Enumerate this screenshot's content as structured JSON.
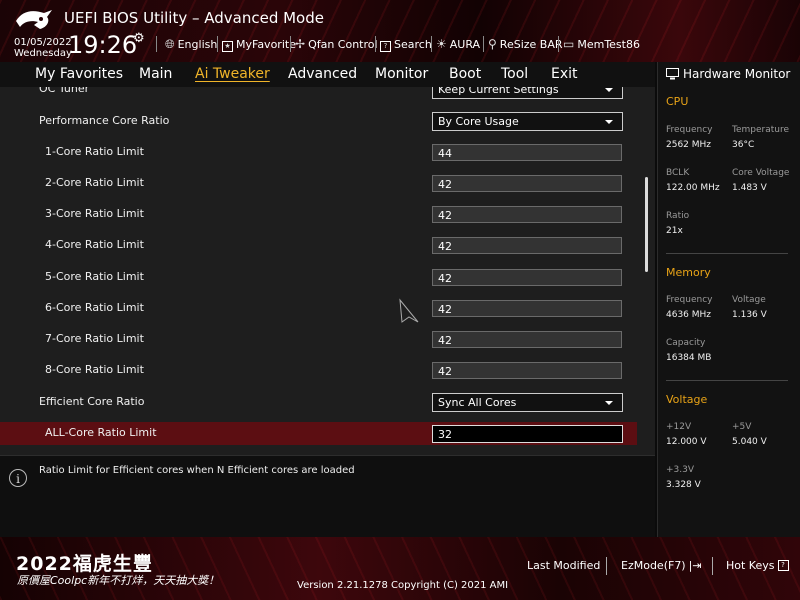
{
  "header": {
    "title": "UEFI BIOS Utility – Advanced Mode",
    "date": "01/05/2022",
    "weekday": "Wednesday",
    "time": "19:26",
    "tools": [
      {
        "label": "English",
        "icon": "globe-icon"
      },
      {
        "label": "MyFavorite",
        "icon": "favorite-icon"
      },
      {
        "label": "Qfan Control",
        "icon": "fan-icon"
      },
      {
        "label": "Search",
        "icon": "search-icon"
      },
      {
        "label": "AURA",
        "icon": "aura-icon"
      },
      {
        "label": "ReSize BAR",
        "icon": "resize-bar-icon"
      },
      {
        "label": "MemTest86",
        "icon": "memtest-icon"
      }
    ]
  },
  "nav": {
    "tabs": [
      {
        "label": "My Favorites"
      },
      {
        "label": "Main"
      },
      {
        "label": "Ai Tweaker",
        "active": true
      },
      {
        "label": "Advanced"
      },
      {
        "label": "Monitor"
      },
      {
        "label": "Boot"
      },
      {
        "label": "Tool"
      },
      {
        "label": "Exit"
      }
    ]
  },
  "settings": {
    "partial_label": "OC Tuner",
    "partial_value": "Keep Current Settings",
    "performance_core_ratio": {
      "label": "Performance Core Ratio",
      "value": "By Core Usage"
    },
    "core_limits": [
      {
        "label": "1-Core Ratio Limit",
        "value": "44"
      },
      {
        "label": "2-Core Ratio Limit",
        "value": "42"
      },
      {
        "label": "3-Core Ratio Limit",
        "value": "42"
      },
      {
        "label": "4-Core Ratio Limit",
        "value": "42"
      },
      {
        "label": "5-Core Ratio Limit",
        "value": "42"
      },
      {
        "label": "6-Core Ratio Limit",
        "value": "42"
      },
      {
        "label": "7-Core Ratio Limit",
        "value": "42"
      },
      {
        "label": "8-Core Ratio Limit",
        "value": "42"
      }
    ],
    "efficient_core_ratio": {
      "label": "Efficient Core Ratio",
      "value": "Sync All Cores"
    },
    "all_core_limit": {
      "label": "ALL-Core Ratio Limit",
      "value": "32"
    }
  },
  "help": {
    "text": "Ratio Limit for Efficient cores when N Efficient cores are loaded"
  },
  "hardware_monitor": {
    "title": "Hardware Monitor",
    "cpu": {
      "title": "CPU",
      "frequency_label": "Frequency",
      "frequency": "2562 MHz",
      "temperature_label": "Temperature",
      "temperature": "36°C",
      "bclk_label": "BCLK",
      "bclk": "122.00 MHz",
      "core_voltage_label": "Core Voltage",
      "core_voltage": "1.483 V",
      "ratio_label": "Ratio",
      "ratio": "21x"
    },
    "memory": {
      "title": "Memory",
      "frequency_label": "Frequency",
      "frequency": "4636 MHz",
      "voltage_label": "Voltage",
      "voltage": "1.136 V",
      "capacity_label": "Capacity",
      "capacity": "16384 MB"
    },
    "voltage": {
      "title": "Voltage",
      "v12_label": "+12V",
      "v12": "12.000 V",
      "v5_label": "+5V",
      "v5": "5.040 V",
      "v33_label": "+3.3V",
      "v33": "3.328 V"
    }
  },
  "footer": {
    "promo_line1": "2022福虎生豐",
    "promo_line2": "原價屋Coolpc新年不打烊，天天抽大獎！",
    "version": "Version 2.21.1278 Copyright (C) 2021 AMI",
    "last_modified": "Last Modified",
    "ezmode": "EzMode(F7)",
    "hot_keys": "Hot Keys",
    "hot_keys_glyph": "?"
  },
  "colors": {
    "accent": "#f0b429",
    "section": "#e8a317",
    "highlight_row": "#5c0e12"
  }
}
